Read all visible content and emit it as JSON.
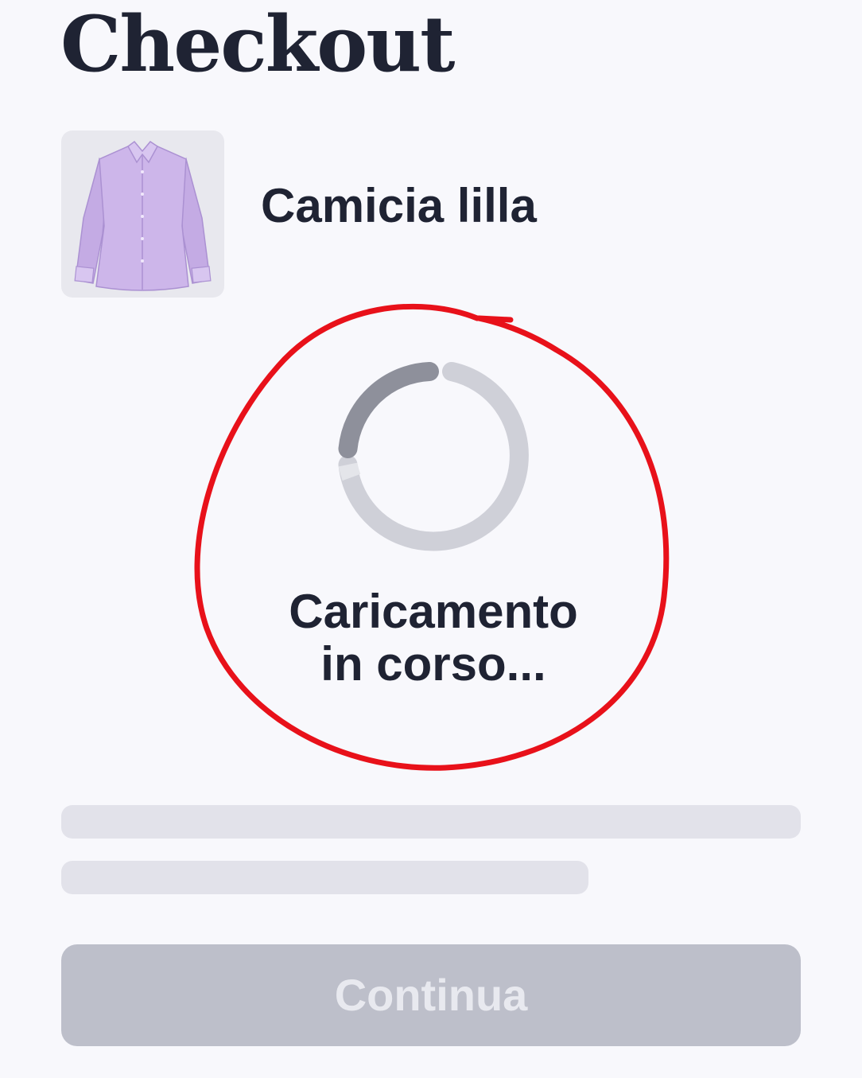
{
  "page": {
    "title": "Checkout"
  },
  "product": {
    "name": "Camicia lilla",
    "image_icon": "lilac-shirt-image",
    "shirt_color": "#c9b2e8"
  },
  "loading": {
    "line1": "Caricamento",
    "line2": "in corso...",
    "spinner_icon": "loading-spinner-icon",
    "annotation_color": "#e8111a"
  },
  "footer": {
    "continue_label": "Continua",
    "continue_disabled": true
  },
  "colors": {
    "background": "#f8f8fc",
    "text": "#1f2333",
    "skeleton": "#e2e2ea",
    "button_disabled": "#bdbfca"
  }
}
